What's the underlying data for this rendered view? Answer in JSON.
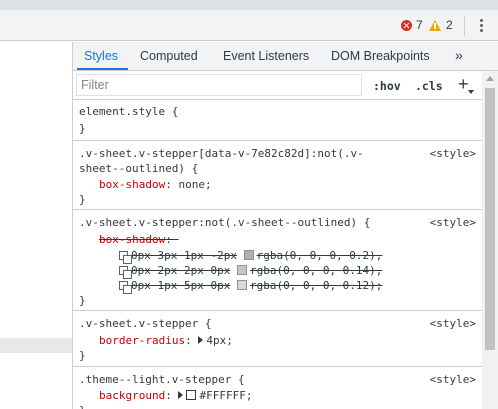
{
  "toolbar": {
    "error_count": "7",
    "warning_count": "2"
  },
  "tabs": [
    {
      "label": "Styles"
    },
    {
      "label": "Computed"
    },
    {
      "label": "Event Listeners"
    },
    {
      "label": "DOM Breakpoints"
    }
  ],
  "tabs_more": "»",
  "filter": {
    "placeholder": "Filter",
    "hov": ":hov",
    "cls": ".cls",
    "add": "+"
  },
  "rules": [
    {
      "selector": "element.style {",
      "close": "}"
    },
    {
      "selector_line1": ".v-sheet.v-stepper[data-v-7e82c82d]:not(.v-",
      "selector_line2": "sheet--outlined) {",
      "source": "<style>",
      "prop": "box-shadow",
      "value": "none;",
      "close": "}"
    },
    {
      "selector": ".v-sheet.v-stepper:not(.v-sheet--outlined) {",
      "source": "<style>",
      "prop": "box-shadow",
      "shadows": [
        {
          "offsets": "0px 3px 1px -2px",
          "color": "rgba(0, 0, 0, 0.2),"
        },
        {
          "offsets": "0px 2px 2px 0px",
          "color": "rgba(0, 0, 0, 0.14),"
        },
        {
          "offsets": "0px 1px 5px 0px",
          "color": "rgba(0, 0, 0, 0.12);"
        }
      ],
      "close": "}"
    },
    {
      "selector": ".v-sheet.v-stepper {",
      "source": "<style>",
      "prop": "border-radius",
      "value": "4px;",
      "close": "}"
    },
    {
      "selector": ".theme--light.v-stepper {",
      "source": "<style>",
      "prop": "background",
      "value": "#FFFFFF;",
      "close": "}"
    }
  ]
}
